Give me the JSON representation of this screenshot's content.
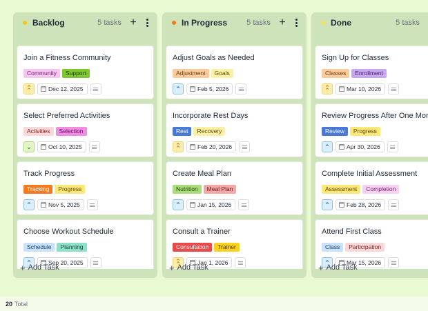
{
  "columns": [
    {
      "title": "Backlog",
      "count": "5 tasks",
      "dot_color": "#f5c518",
      "add_icon": "plus-icon",
      "more_icon": "more-vertical-icon",
      "add_task_label": "Add Task",
      "cards": [
        {
          "title": "Join a Fitness Community",
          "tags": [
            {
              "label": "Community",
              "bg": "#f6c6f0",
              "fg": "#6b1f63"
            },
            {
              "label": "Support",
              "bg": "#7dc82a",
              "fg": "#1f3d05"
            }
          ],
          "priority": "high",
          "priority_symbol": "⌃",
          "date": "Dec 12, 2025"
        },
        {
          "title": "Select Preferred Activities",
          "tags": [
            {
              "label": "Activities",
              "bg": "#fbd7d7",
              "fg": "#7a2626"
            },
            {
              "label": "Selection",
              "bg": "#f08ce4",
              "fg": "#5b0f53"
            }
          ],
          "priority": "low",
          "priority_symbol": "⌄",
          "date": "Oct 10, 2025"
        },
        {
          "title": "Track Progress",
          "tags": [
            {
              "label": "Tracking",
              "bg": "#f57a1f",
              "fg": "#ffffff"
            },
            {
              "label": "Progress",
              "bg": "#fbe77a",
              "fg": "#5a4a05"
            }
          ],
          "priority": "medium",
          "priority_symbol": "⌃",
          "date": "Nov 5, 2025"
        },
        {
          "title": "Choose Workout Schedule",
          "tags": [
            {
              "label": "Schedule",
              "bg": "#c9e2fb",
              "fg": "#1f3f66"
            },
            {
              "label": "Planning",
              "bg": "#8fe0c8",
              "fg": "#0f4a3a"
            }
          ],
          "priority": "medium",
          "priority_symbol": "⌃",
          "date": "Sep 20, 2025"
        }
      ]
    },
    {
      "title": "In Progress",
      "count": "5 tasks",
      "dot_color": "#f57a1f",
      "add_icon": "plus-icon",
      "more_icon": "more-vertical-icon",
      "add_task_label": "Add Task",
      "cards": [
        {
          "title": "Adjust Goals as Needed",
          "tags": [
            {
              "label": "Adjustment",
              "bg": "#fbcb9e",
              "fg": "#6b3a08"
            },
            {
              "label": "Goals",
              "bg": "#fbf0a6",
              "fg": "#5a4a05"
            }
          ],
          "priority": "medium",
          "priority_symbol": "⌃",
          "date": "Feb 5, 2026"
        },
        {
          "title": "Incorporate Rest Days",
          "tags": [
            {
              "label": "Rest",
              "bg": "#4a78d6",
              "fg": "#ffffff"
            },
            {
              "label": "Recovery",
              "bg": "#fbf0a6",
              "fg": "#5a4a05"
            }
          ],
          "priority": "high",
          "priority_symbol": "⌃",
          "date": "Feb 20, 2026"
        },
        {
          "title": "Create Meal Plan",
          "tags": [
            {
              "label": "Nutrition",
              "bg": "#a8dc7a",
              "fg": "#25450b"
            },
            {
              "label": "Meal Plan",
              "bg": "#f3a8a8",
              "fg": "#6b1a1a"
            }
          ],
          "priority": "medium",
          "priority_symbol": "⌃",
          "date": "Jan 15, 2026"
        },
        {
          "title": "Consult a Trainer",
          "tags": [
            {
              "label": "Consultation",
              "bg": "#e84a4a",
              "fg": "#ffffff"
            },
            {
              "label": "Trainer",
              "bg": "#fbd21f",
              "fg": "#4a3a02"
            }
          ],
          "priority": "high",
          "priority_symbol": "⌃",
          "date": "Jan 1, 2026"
        }
      ]
    },
    {
      "title": "Done",
      "count": "5 tasks",
      "dot_color": "#fbe05a",
      "add_icon": "plus-icon",
      "more_icon": "more-vertical-icon",
      "add_task_label": "Add Task",
      "cards": [
        {
          "title": "Sign Up for Classes",
          "tags": [
            {
              "label": "Classes",
              "bg": "#fbcb9e",
              "fg": "#6b3a08"
            },
            {
              "label": "Enrollment",
              "bg": "#c8a6f0",
              "fg": "#3f1f6b"
            }
          ],
          "priority": "high",
          "priority_symbol": "⌃",
          "date": "Mar 10, 2026"
        },
        {
          "title": "Review Progress After One Month",
          "tags": [
            {
              "label": "Review",
              "bg": "#4a78d6",
              "fg": "#ffffff"
            },
            {
              "label": "Progress",
              "bg": "#fbe77a",
              "fg": "#5a4a05"
            }
          ],
          "priority": "medium",
          "priority_symbol": "⌃",
          "date": "Apr 30, 2026"
        },
        {
          "title": "Complete Initial Assessment",
          "tags": [
            {
              "label": "Assessment",
              "bg": "#fbe77a",
              "fg": "#5a4a05"
            },
            {
              "label": "Completion",
              "bg": "#f9d2f3",
              "fg": "#6b1f63"
            }
          ],
          "priority": "medium",
          "priority_symbol": "⌃",
          "date": "Feb 28, 2026"
        },
        {
          "title": "Attend First Class",
          "tags": [
            {
              "label": "Class",
              "bg": "#c9e2fb",
              "fg": "#1f3f66"
            },
            {
              "label": "Participation",
              "bg": "#fbd7d7",
              "fg": "#7a2626"
            }
          ],
          "priority": "medium",
          "priority_symbol": "⌃",
          "date": "Mar 15, 2026"
        }
      ]
    }
  ],
  "priority_styles": {
    "high": {
      "bg": "#fdeeb0",
      "fg": "#c98a0a",
      "border": "#f5d36a"
    },
    "medium": {
      "bg": "#dbeefc",
      "fg": "#2f6fb5",
      "border": "#8cc0ea"
    },
    "low": {
      "bg": "#e3f5c8",
      "fg": "#5e9a1c",
      "border": "#a9d67a"
    }
  },
  "icons": {
    "calendar": "calendar-icon",
    "description": "description-icon"
  },
  "footer": {
    "count": "20",
    "label": "Total"
  }
}
